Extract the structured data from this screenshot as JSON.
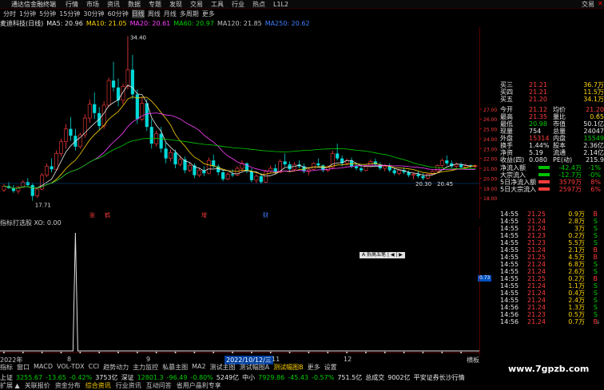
{
  "menu": {
    "brand": "通达信金融终端",
    "items": [
      "行情",
      "市场",
      "资讯",
      "数据",
      "专题",
      "发现",
      "交易",
      "工具",
      "行业",
      "热点",
      "L1L2"
    ],
    "right": "交易"
  },
  "periods": [
    "分时",
    "1分钟",
    "5分钟",
    "15分钟",
    "30分钟",
    "60分钟",
    "日线",
    "周线",
    "月线",
    "多周期",
    "更多"
  ],
  "active_period": "日线",
  "indicators": {
    "stock": "麦迪科技(日线)",
    "ma5": "MA5: 20.96",
    "ma10": "MA10: 21.05",
    "ma20": "MA20: 20.61",
    "ma60": "MA60: 20.97",
    "ma120": "MA120: 21.85",
    "ma250": "MA250: 20.62"
  },
  "chart_labels": {
    "high": "34.40",
    "low": "17.71",
    "range_low": "20.30",
    "range_high": "20.45",
    "markers": [
      "张",
      "鹤",
      "增",
      "财"
    ]
  },
  "price_axis": [
    "27.00",
    "26.00",
    "25.00",
    "24.00",
    "23.00",
    "22.00",
    "21.00",
    "20.00",
    "19.00",
    "18.00"
  ],
  "lower_header": "指标打选股 XO: 0.00",
  "sub_value": "0.73",
  "popup": "A 拆高五笔 | ◀ | ▶",
  "date_bar": {
    "year": "2022年",
    "sel": "2022/10/12/三",
    "marks": [
      "8",
      "9",
      "11",
      "12"
    ],
    "right": "横板"
  },
  "tabs": [
    "指标",
    "窗口",
    "MACD",
    "VOL-TDX",
    "CCI",
    "趋势动力",
    "主力监控",
    "私募主图",
    "MA2",
    "测试主图",
    "测试幅图A",
    "测试幅图B",
    "更多",
    "设置"
  ],
  "active_tab": "测试幅图B",
  "quote_panel": {
    "rows": [
      {
        "l1": "买三",
        "v1": "21.21",
        "v2": "36.7万",
        "c": "red"
      },
      {
        "l1": "买四",
        "v1": "21.21",
        "v2": "11.5万",
        "c": "red"
      },
      {
        "l1": "买五",
        "v1": "21.20",
        "v2": "34.1万",
        "c": "red"
      }
    ],
    "stats": [
      {
        "a": "今开",
        "av": "21.12",
        "b": "均价",
        "bv": "21.20"
      },
      {
        "a": "最高",
        "av": "21.35",
        "b": "量比",
        "bv": "0.65"
      },
      {
        "a": "最低",
        "av": "20.98",
        "b": "市值",
        "bv": "50.1亿"
      },
      {
        "a": "现量",
        "av": "754",
        "b": "总量",
        "bv": "24047"
      },
      {
        "a": "外盘",
        "av": "15314",
        "b": "内盘",
        "bv": "15549"
      },
      {
        "a": "换手",
        "av": "1.44%",
        "b": "股本",
        "bv": "2.36亿"
      },
      {
        "a": "净资",
        "av": "5.19",
        "b": "流通",
        "bv": "2.14亿"
      },
      {
        "a": "收益(四)",
        "av": "0.080",
        "b": "PE(动)",
        "bv": "215.9"
      }
    ],
    "flows": [
      {
        "a": "净流入额",
        "av": "-42.4万",
        "bv": "-1%"
      },
      {
        "a": "大宗流入",
        "av": "-12.7万",
        "bv": "-0%"
      },
      {
        "a": "5日净流入额",
        "av": "3579万",
        "bv": "8%"
      },
      {
        "a": "5日大宗流入",
        "av": "2597万",
        "bv": "6%"
      }
    ]
  },
  "ticks": [
    {
      "t": "14:55",
      "p": "21.25",
      "v": "0.9万",
      "s": "B"
    },
    {
      "t": "14:55",
      "p": "21.24",
      "v": "2.8万",
      "s": "S"
    },
    {
      "t": "14:55",
      "p": "21.24",
      "v": "3万",
      "s": "S"
    },
    {
      "t": "14:55",
      "p": "21.23",
      "v": "0.2万",
      "s": "S"
    },
    {
      "t": "14:55",
      "p": "21.23",
      "v": "5.5万",
      "s": "S"
    },
    {
      "t": "14:55",
      "p": "21.24",
      "v": "2.1万",
      "s": "B"
    },
    {
      "t": "14:55",
      "p": "21.25",
      "v": "4.5万",
      "s": "B"
    },
    {
      "t": "14:55",
      "p": "21.24",
      "v": "6.8万",
      "s": "S"
    },
    {
      "t": "14:55",
      "p": "21.24",
      "v": "2.6万",
      "s": "S"
    },
    {
      "t": "14:55",
      "p": "21.25",
      "v": "0.2万",
      "s": "B"
    },
    {
      "t": "14:55",
      "p": "21.24",
      "v": "1.1万",
      "s": "S"
    },
    {
      "t": "14:55",
      "p": "21.24",
      "v": "0.4万",
      "s": "S"
    },
    {
      "t": "14:55",
      "p": "21.24",
      "v": "2.4万",
      "s": "S"
    },
    {
      "t": "14:56",
      "p": "21.24",
      "v": "1.3万",
      "s": "S"
    },
    {
      "t": "14:56",
      "p": "21.23",
      "v": "0.5万",
      "s": "S"
    },
    {
      "t": "14:56",
      "p": "21.24",
      "v": "0.7万",
      "s": "B"
    }
  ],
  "bottom": {
    "sh": "上证",
    "sh_v": "3255.67",
    "sh_c": "-13.65",
    "sh_p": "-0.42%",
    "sh_a": "3753亿",
    "sz": "深证",
    "sz_v": "12801.3",
    "sz_c": "-96.49",
    "sz_p": "-0.80%",
    "sz_a": "5249亿",
    "zx": "中小",
    "zx_v": "7929.86",
    "zx_c": "-45.43",
    "zx_p": "-0.57%",
    "zx_a": "751.5亿",
    "zc": "总成交",
    "zc_v": "9002亿",
    "srv": "平安证券长沙行情"
  },
  "bottom2": [
    "扩展 ▲",
    "关联报价",
    "资金分布",
    "综合资讯",
    "行业资讯",
    "互动问答",
    "省用户晶利专享"
  ],
  "watermark": "www.7gpzb.com",
  "candles": {
    "data": [
      [
        18.8,
        19.4,
        18.6,
        19.2
      ],
      [
        19.2,
        19.6,
        18.9,
        19.0
      ],
      [
        19.0,
        19.3,
        18.5,
        18.7
      ],
      [
        18.7,
        19.2,
        18.4,
        19.1
      ],
      [
        19.1,
        19.8,
        19.0,
        19.6
      ],
      [
        19.6,
        20.0,
        19.1,
        19.3
      ],
      [
        19.3,
        19.5,
        17.71,
        18.2
      ],
      [
        18.2,
        19.0,
        18.0,
        18.9
      ],
      [
        18.9,
        20.5,
        18.8,
        20.3
      ],
      [
        20.3,
        21.5,
        20.1,
        21.2
      ],
      [
        21.2,
        22.0,
        20.6,
        20.9
      ],
      [
        20.9,
        22.8,
        20.8,
        22.5
      ],
      [
        22.5,
        24.0,
        22.2,
        23.7
      ],
      [
        23.7,
        25.5,
        23.0,
        25.0
      ],
      [
        25.0,
        26.2,
        23.8,
        24.3
      ],
      [
        24.3,
        25.0,
        22.8,
        23.2
      ],
      [
        23.2,
        24.6,
        23.0,
        24.4
      ],
      [
        24.4,
        26.5,
        24.1,
        26.1
      ],
      [
        26.1,
        28.0,
        25.6,
        27.5
      ],
      [
        27.5,
        28.7,
        26.0,
        26.6
      ],
      [
        26.6,
        27.2,
        24.9,
        25.3
      ],
      [
        25.3,
        27.8,
        25.0,
        27.4
      ],
      [
        27.4,
        30.2,
        27.2,
        29.9
      ],
      [
        29.9,
        31.8,
        28.8,
        29.2
      ],
      [
        29.2,
        30.1,
        27.3,
        27.9
      ],
      [
        27.9,
        29.6,
        27.5,
        29.3
      ],
      [
        29.3,
        34.4,
        29.0,
        31.0
      ],
      [
        31.0,
        32.5,
        28.0,
        28.5
      ],
      [
        28.5,
        29.0,
        25.5,
        26.0
      ],
      [
        26.0,
        28.2,
        25.8,
        27.6
      ],
      [
        27.6,
        28.0,
        24.8,
        25.2
      ],
      [
        25.2,
        26.0,
        23.0,
        23.5
      ],
      [
        23.5,
        24.8,
        23.2,
        24.5
      ],
      [
        24.5,
        25.2,
        22.6,
        23.0
      ],
      [
        23.0,
        23.6,
        21.5,
        22.0
      ],
      [
        22.0,
        22.9,
        21.7,
        22.6
      ],
      [
        22.6,
        22.9,
        21.0,
        21.4
      ],
      [
        21.4,
        22.3,
        21.2,
        21.9
      ],
      [
        21.9,
        22.2,
        20.5,
        20.8
      ],
      [
        20.8,
        21.6,
        20.6,
        21.3
      ],
      [
        21.3,
        21.5,
        20.0,
        20.3
      ],
      [
        20.3,
        21.0,
        20.1,
        20.8
      ],
      [
        20.8,
        21.2,
        20.2,
        20.5
      ],
      [
        20.5,
        22.1,
        20.4,
        21.8
      ],
      [
        21.8,
        22.4,
        21.0,
        21.2
      ],
      [
        21.2,
        21.4,
        20.3,
        20.6
      ],
      [
        20.6,
        20.9,
        19.7,
        19.9
      ],
      [
        19.9,
        20.6,
        19.8,
        20.4
      ],
      [
        20.4,
        20.9,
        20.1,
        20.3
      ],
      [
        20.3,
        21.2,
        20.2,
        21.0
      ],
      [
        21.0,
        21.8,
        20.7,
        21.5
      ],
      [
        21.5,
        21.6,
        20.5,
        20.7
      ],
      [
        20.7,
        21.0,
        19.6,
        19.8
      ],
      [
        19.8,
        20.4,
        19.5,
        20.2
      ],
      [
        20.2,
        20.5,
        19.4,
        19.6
      ],
      [
        19.6,
        20.8,
        19.5,
        20.7
      ],
      [
        20.7,
        21.3,
        20.5,
        21.0
      ],
      [
        21.0,
        21.4,
        20.4,
        20.6
      ],
      [
        20.6,
        21.9,
        20.5,
        21.7
      ],
      [
        21.7,
        22.5,
        21.2,
        21.4
      ],
      [
        21.4,
        21.7,
        20.6,
        20.9
      ],
      [
        20.9,
        21.6,
        20.7,
        21.4
      ],
      [
        21.4,
        21.8,
        21.0,
        21.2
      ],
      [
        21.2,
        21.5,
        20.5,
        20.7
      ],
      [
        20.7,
        21.1,
        20.3,
        20.9
      ],
      [
        20.9,
        21.6,
        20.8,
        21.5
      ],
      [
        21.5,
        22.0,
        21.1,
        21.3
      ],
      [
        21.3,
        21.4,
        20.6,
        20.8
      ],
      [
        20.8,
        21.3,
        20.6,
        21.1
      ],
      [
        21.1,
        22.8,
        21.0,
        22.5
      ],
      [
        22.5,
        23.5,
        21.8,
        22.0
      ],
      [
        22.0,
        22.3,
        21.2,
        21.5
      ],
      [
        21.5,
        22.0,
        21.3,
        21.8
      ],
      [
        21.8,
        22.1,
        21.0,
        21.2
      ],
      [
        21.2,
        21.6,
        20.8,
        21.0
      ],
      [
        21.0,
        21.4,
        20.6,
        20.8
      ],
      [
        20.8,
        21.3,
        20.7,
        21.2
      ],
      [
        21.2,
        21.9,
        21.1,
        21.7
      ],
      [
        21.7,
        22.0,
        21.2,
        21.4
      ],
      [
        21.4,
        21.6,
        20.8,
        21.0
      ],
      [
        21.0,
        21.4,
        20.7,
        21.2
      ],
      [
        21.2,
        21.5,
        20.6,
        20.8
      ],
      [
        20.8,
        21.0,
        20.3,
        20.5
      ],
      [
        20.5,
        20.9,
        20.3,
        20.8
      ],
      [
        20.8,
        21.1,
        20.4,
        20.6
      ],
      [
        20.6,
        20.8,
        20.1,
        20.3
      ],
      [
        20.3,
        20.6,
        19.9,
        20.4
      ],
      [
        20.4,
        20.7,
        20.0,
        20.2
      ],
      [
        20.2,
        20.5,
        19.8,
        20.0
      ],
      [
        20.0,
        20.5,
        19.9,
        20.4
      ],
      [
        20.4,
        20.8,
        20.3,
        20.7
      ],
      [
        20.7,
        21.4,
        20.6,
        21.3
      ],
      [
        21.3,
        22.0,
        21.1,
        21.8
      ],
      [
        21.8,
        22.3,
        21.3,
        21.5
      ],
      [
        21.5,
        21.8,
        21.0,
        21.2
      ],
      [
        21.2,
        21.6,
        21.0,
        21.4
      ],
      [
        21.4,
        21.6,
        20.9,
        21.1
      ],
      [
        21.1,
        21.5,
        20.9,
        21.3
      ],
      [
        21.3,
        21.4,
        21.0,
        21.2
      ],
      [
        21.2,
        21.4,
        20.98,
        21.25
      ]
    ]
  },
  "sub_spike_index": 15
}
